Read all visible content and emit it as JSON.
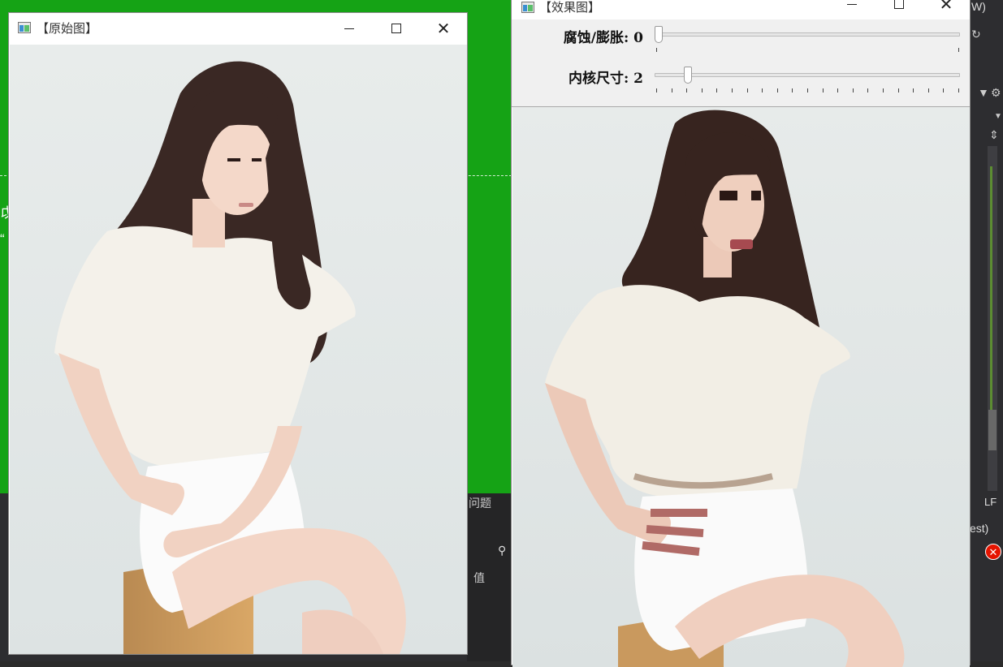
{
  "background": {
    "left_chars": [
      "戉",
      "“"
    ],
    "panel_label_problem": "问题",
    "panel_label_value": "值",
    "right_top_text": "W)",
    "right_status_lf": "LF",
    "right_status_est": "est)"
  },
  "original_window": {
    "title": "【原始图】",
    "image_alt": "portrait photo — original"
  },
  "result_window": {
    "title": "【效果图】",
    "image_alt": "portrait photo — eroded/dilated effect",
    "trackbars": [
      {
        "label": "腐蚀/膨胀:",
        "value": "0",
        "position_fraction": 0.0,
        "tick_count": 2
      },
      {
        "label": "内核尺寸:",
        "value": "2",
        "position_fraction": 0.1,
        "tick_count": 21
      }
    ]
  },
  "colors": {
    "desktop_green": "#15a315",
    "ide_dark": "#2d2d30",
    "error_red": "#e51400"
  },
  "icons": [
    "app-icon",
    "minimize-icon",
    "maximize-icon",
    "close-icon",
    "error-icon"
  ]
}
